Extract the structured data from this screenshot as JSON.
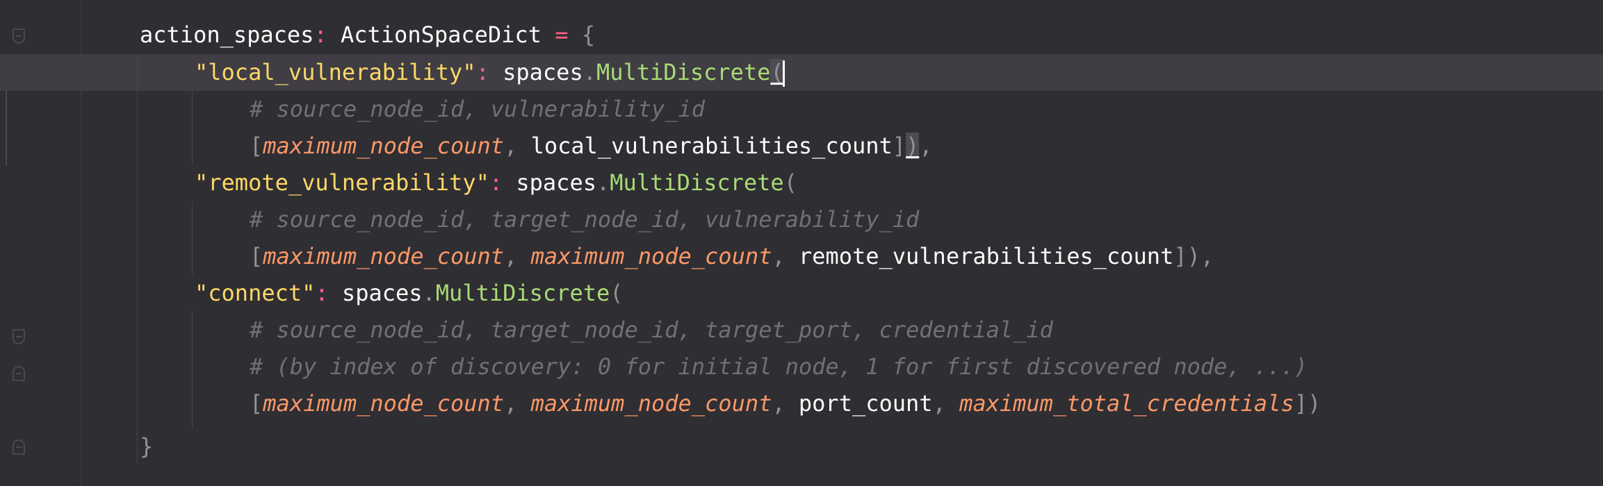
{
  "code": {
    "line1": {
      "var": "action_spaces",
      "colon": ":",
      "type": "ActionSpaceDict",
      "eq": "=",
      "brace": "{"
    },
    "line2": {
      "key": "\"local_vulnerability\"",
      "colon": ":",
      "obj": "spaces",
      "dot": ".",
      "cls": "MultiDiscrete",
      "paren": "("
    },
    "line3": {
      "comment": "# source_node_id, vulnerability_id"
    },
    "line4": {
      "open": "[",
      "p1": "maximum_node_count",
      "comma1": ", ",
      "v2": "local_vulnerabilities_count",
      "close": "]",
      "paren": ")",
      "comma": ","
    },
    "line5": {
      "key": "\"remote_vulnerability\"",
      "colon": ":",
      "obj": "spaces",
      "dot": ".",
      "cls": "MultiDiscrete",
      "paren": "("
    },
    "line6": {
      "comment": "# source_node_id, target_node_id, vulnerability_id"
    },
    "line7": {
      "open": "[",
      "p1": "maximum_node_count",
      "comma1": ", ",
      "p2": "maximum_node_count",
      "comma2": ", ",
      "v3": "remote_vulnerabilities_count",
      "close": "]),"
    },
    "line8": {
      "key": "\"connect\"",
      "colon": ":",
      "obj": "spaces",
      "dot": ".",
      "cls": "MultiDiscrete",
      "paren": "("
    },
    "line9": {
      "comment": "# source_node_id, target_node_id, target_port, credential_id"
    },
    "line10": {
      "comment": "# (by index of discovery: 0 for initial node, 1 for first discovered node, ...)"
    },
    "line11": {
      "open": "[",
      "p1": "maximum_node_count",
      "comma1": ", ",
      "p2": "maximum_node_count",
      "comma2": ", ",
      "v3": "port_count",
      "comma3": ", ",
      "p4": "maximum_total_credentials",
      "close": "])"
    },
    "line12": {
      "brace": "}"
    }
  },
  "colors": {
    "background": "#2f2e33",
    "current_line": "#403e44",
    "string": "#ffd866",
    "keyword": "#ff6188",
    "function": "#a9dc76",
    "parameter": "#fc9867",
    "comment": "#727072"
  }
}
